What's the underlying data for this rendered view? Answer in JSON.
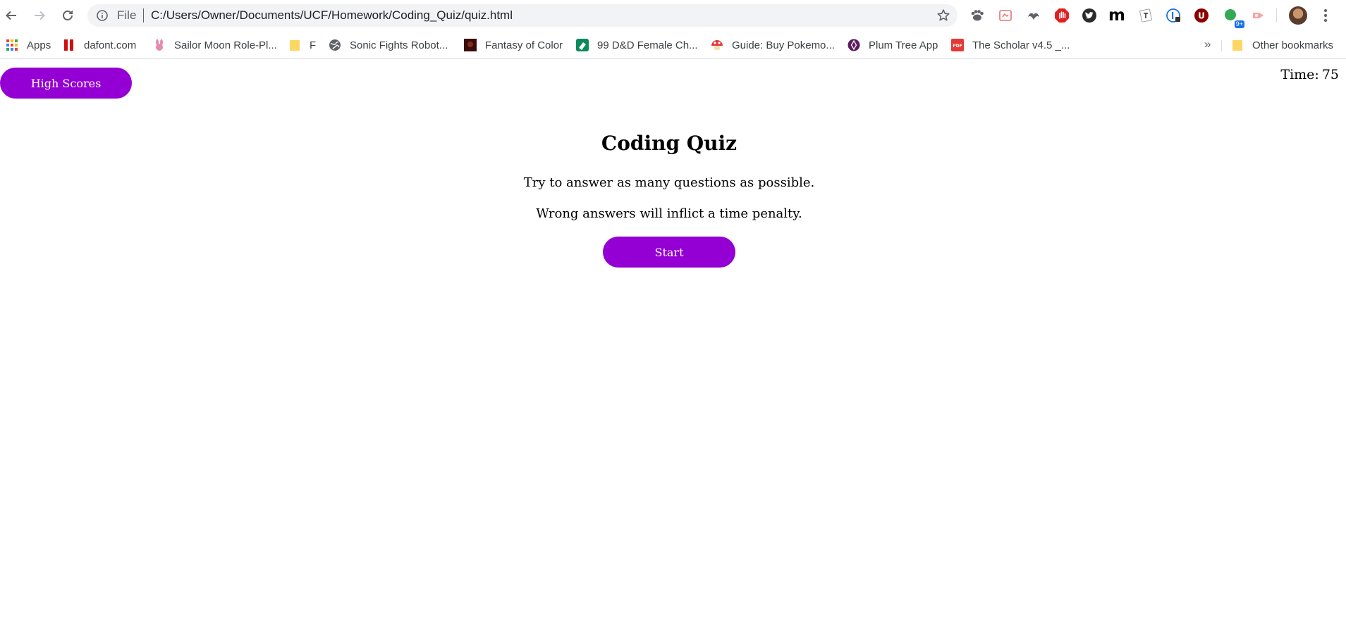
{
  "browser": {
    "omnibox": {
      "scheme": "File",
      "url": "C:/Users/Owner/Documents/UCF/Homework/Coding_Quiz/quiz.html"
    },
    "extensions": [
      {
        "name": "pawprint-extension-icon"
      },
      {
        "name": "stamp-extension-icon"
      },
      {
        "name": "ornament-extension-icon"
      },
      {
        "name": "hand-stop-extension-icon"
      },
      {
        "name": "twitter-extension-icon"
      },
      {
        "name": "m-extension-icon",
        "label": "m"
      },
      {
        "name": "text-tool-extension-icon"
      },
      {
        "name": "password-extension-icon"
      },
      {
        "name": "u-extension-icon",
        "label": "U"
      },
      {
        "name": "green-dot-extension-icon",
        "badge": "9+"
      },
      {
        "name": "share-extension-icon"
      }
    ],
    "colors": {
      "accent": "#9400d3",
      "toolbar_bg": "#ffffff",
      "omnibox_bg": "#f1f3f4"
    }
  },
  "bookmarks": {
    "apps": "Apps",
    "items": [
      {
        "label": "dafont.com",
        "icon": "dafont-icon"
      },
      {
        "label": "Sailor Moon Role-Pl...",
        "icon": "bunny-icon"
      },
      {
        "label": "F",
        "icon": "folder-icon"
      },
      {
        "label": "Sonic Fights Robot...",
        "icon": "globe-icon"
      },
      {
        "label": "Fantasy of Color",
        "icon": "fantasy-icon"
      },
      {
        "label": "99 D&D Female Ch...",
        "icon": "dnd-icon"
      },
      {
        "label": "Guide: Buy Pokemo...",
        "icon": "mushroom-icon"
      },
      {
        "label": "Plum Tree App",
        "icon": "plum-icon"
      },
      {
        "label": "The Scholar v4.5 _...",
        "icon": "pdf-icon"
      }
    ],
    "overflow": "»",
    "other": "Other bookmarks"
  },
  "page": {
    "high_scores_label": "High Scores",
    "timer_label": "Time:",
    "timer_value": "75",
    "title": "Coding Quiz",
    "line1": "Try to answer as many questions as possible.",
    "line2": "Wrong answers will inflict a time penalty.",
    "start_label": "Start"
  }
}
